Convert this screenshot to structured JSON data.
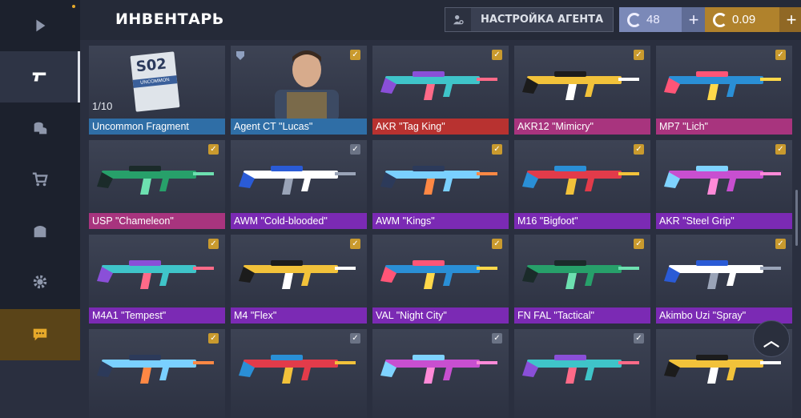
{
  "header": {
    "title": "ИНВЕНТАРЬ",
    "agent_settings_label": "НАСТРОЙКА АГЕНТА",
    "silver_balance": "48",
    "gold_balance": "0.09"
  },
  "sidebar": {
    "items": [
      {
        "icon": "play-icon",
        "active": false
      },
      {
        "icon": "pistol-icon",
        "active": true
      },
      {
        "icon": "coins-icon",
        "active": false
      },
      {
        "icon": "cart-icon",
        "active": false
      },
      {
        "icon": "gift-icon",
        "active": false
      },
      {
        "icon": "gear-icon",
        "active": false
      },
      {
        "icon": "chat-icon",
        "active": false
      }
    ]
  },
  "fragment": {
    "code": "S02",
    "rarity": "UNCOMMON",
    "count": "1/10"
  },
  "items": [
    {
      "label": "Uncommon Fragment",
      "rarity": "blue",
      "checked": false
    },
    {
      "label": "Agent CT \"Lucas\"",
      "rarity": "blue",
      "checked": true
    },
    {
      "label": "AKR \"Tag King\"",
      "rarity": "red",
      "checked": true
    },
    {
      "label": "AKR12 \"Mimicry\"",
      "rarity": "pink",
      "checked": true
    },
    {
      "label": "MP7 \"Lich\"",
      "rarity": "pink",
      "checked": true
    },
    {
      "label": "USP \"Chameleon\"",
      "rarity": "pink",
      "checked": true
    },
    {
      "label": "AWM \"Cold-blooded\"",
      "rarity": "purple",
      "checked": false
    },
    {
      "label": "AWM \"Kings\"",
      "rarity": "purple",
      "checked": true
    },
    {
      "label": "M16 \"Bigfoot\"",
      "rarity": "purple",
      "checked": true
    },
    {
      "label": "AKR \"Steel Grip\"",
      "rarity": "purple",
      "checked": true
    },
    {
      "label": "M4A1 \"Tempest\"",
      "rarity": "purple",
      "checked": true
    },
    {
      "label": "M4 \"Flex\"",
      "rarity": "purple",
      "checked": true
    },
    {
      "label": "VAL \"Night City\"",
      "rarity": "purple",
      "checked": true
    },
    {
      "label": "FN FAL \"Tactical\"",
      "rarity": "purple",
      "checked": true
    },
    {
      "label": "Akimbo Uzi \"Spray\"",
      "rarity": "purple",
      "checked": true
    },
    {
      "label": "",
      "rarity": "purple",
      "checked": true
    },
    {
      "label": "",
      "rarity": "purple",
      "checked": false
    },
    {
      "label": "",
      "rarity": "purple",
      "checked": false
    },
    {
      "label": "",
      "rarity": "purple",
      "checked": false
    },
    {
      "label": "",
      "rarity": "purple",
      "checked": false
    }
  ],
  "colors": {
    "blue": "#2f6ea6",
    "purple": "#7b2ab4",
    "red": "#b83230",
    "pink": "#a8347e",
    "gold": "#c99a2e"
  }
}
